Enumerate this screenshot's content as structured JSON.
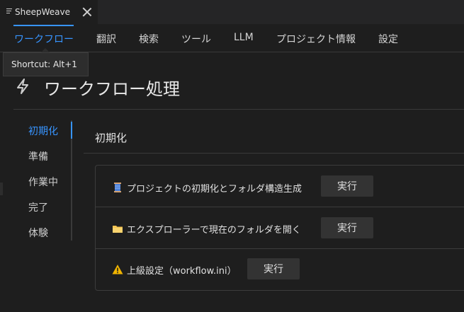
{
  "tab": {
    "title": "SheepWeave"
  },
  "menu": {
    "items": [
      {
        "label": "ワークフロー",
        "active": true
      },
      {
        "label": "翻訳"
      },
      {
        "label": "検索"
      },
      {
        "label": "ツール"
      },
      {
        "label": "LLM"
      },
      {
        "label": "プロジェクト情報"
      },
      {
        "label": "設定"
      }
    ]
  },
  "tooltip": {
    "text": "Shortcut: Alt+1"
  },
  "page": {
    "title": "ワークフロー処理"
  },
  "sidenav": {
    "items": [
      {
        "label": "初期化",
        "active": true
      },
      {
        "label": "準備"
      },
      {
        "label": "作業中"
      },
      {
        "label": "完了"
      },
      {
        "label": "体験"
      }
    ]
  },
  "section": {
    "title": "初期化"
  },
  "actions": [
    {
      "icon": "spool-icon",
      "label": "プロジェクトの初期化とフォルダ構造生成",
      "button": "実行"
    },
    {
      "icon": "folder-icon",
      "label": "エクスプローラーで現在のフォルダを開く",
      "button": "実行"
    },
    {
      "icon": "warning-icon",
      "label": "上級設定（workflow.ini）",
      "button": "実行"
    }
  ],
  "colors": {
    "accent": "#3794ff",
    "background": "#1e1e1e",
    "button": "#333333",
    "warning": "#f0b400",
    "folder": "#f5c451"
  }
}
